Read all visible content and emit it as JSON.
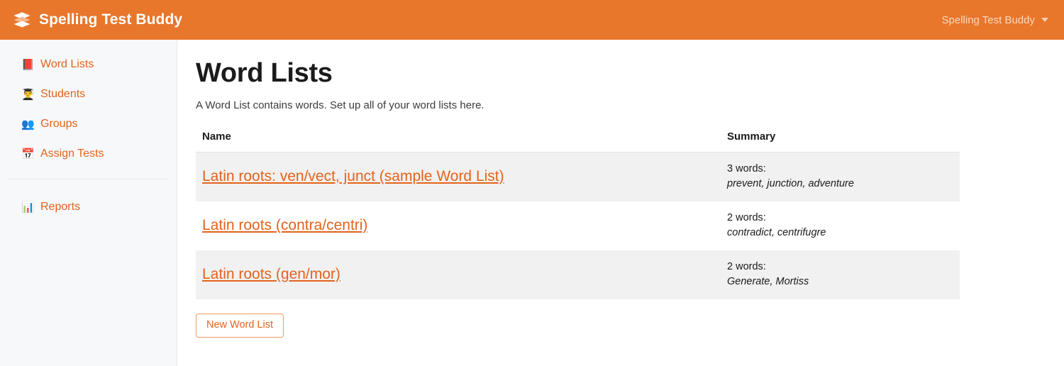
{
  "header": {
    "logo_icon": "layers-stack-icon",
    "brand_title": "Spelling Test Buddy",
    "account_label": "Spelling Test Buddy",
    "account_caret_icon": "chevron-down-icon",
    "background_color": "#e8762b"
  },
  "sidebar": {
    "items": [
      {
        "label": "Word Lists",
        "icon": "📕",
        "icon_name": "closed-book-icon"
      },
      {
        "label": "Students",
        "icon": "👨‍🎓",
        "icon_name": "graduate-student-icon"
      },
      {
        "label": "Groups",
        "icon": "👥",
        "icon_name": "busts-in-silhouette-icon"
      },
      {
        "label": "Assign Tests",
        "icon": "📅",
        "icon_name": "calendar-icon"
      }
    ],
    "secondary_items": [
      {
        "label": "Reports",
        "icon": "📊",
        "icon_name": "bar-chart-icon"
      }
    ],
    "link_color": "#e2631c",
    "background_color": "#f7f8fa"
  },
  "main": {
    "title": "Word Lists",
    "subtitle": "A Word List contains words. Set up all of your word lists here.",
    "table": {
      "columns": [
        "Name",
        "Summary"
      ],
      "rows": [
        {
          "name": "Latin roots: ven/vect, junct (sample Word List)",
          "summary_count": "3 words:",
          "summary_words": "prevent, junction, adventure"
        },
        {
          "name": "Latin roots (contra/centri)",
          "summary_count": "2 words:",
          "summary_words": "contradict, centrifugre"
        },
        {
          "name": "Latin roots (gen/mor)",
          "summary_count": "2 words:",
          "summary_words": "Generate, Mortiss"
        }
      ]
    },
    "new_word_list_button": "New Word List"
  }
}
